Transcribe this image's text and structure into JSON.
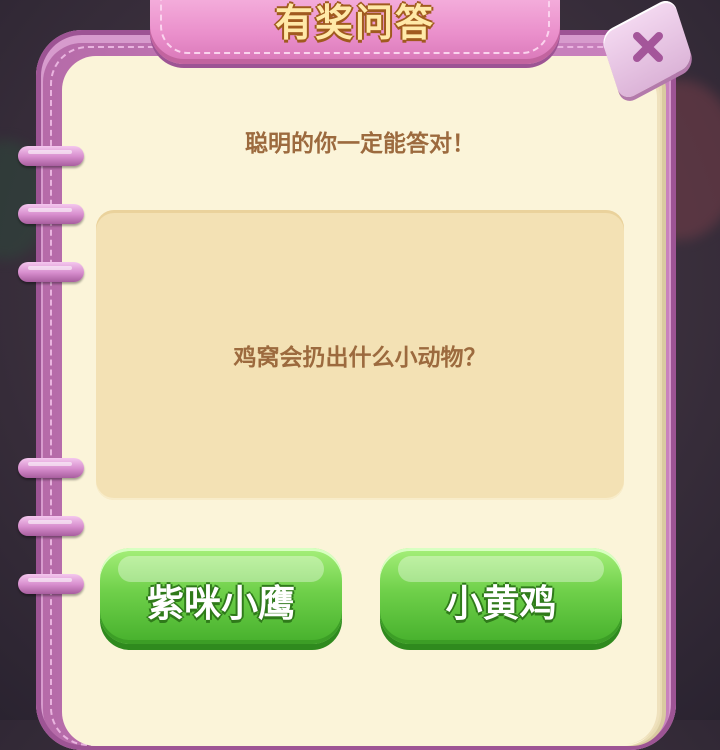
{
  "dialog": {
    "title": "有奖问答",
    "subtitle": "聪明的你一定能答对！",
    "question": "鸡窝会扔出什么小动物？",
    "close_icon": "close-x-icon"
  },
  "answers": [
    {
      "label": "紫咪小鹰"
    },
    {
      "label": "小黄鸡"
    }
  ],
  "colors": {
    "frame": "#c57bb8",
    "paper": "#fbf4d9",
    "question_panel": "#f3e1b4",
    "text": "#9c6a3e",
    "title_text": "#ffe9a8",
    "button_green": "#6fd04a"
  }
}
